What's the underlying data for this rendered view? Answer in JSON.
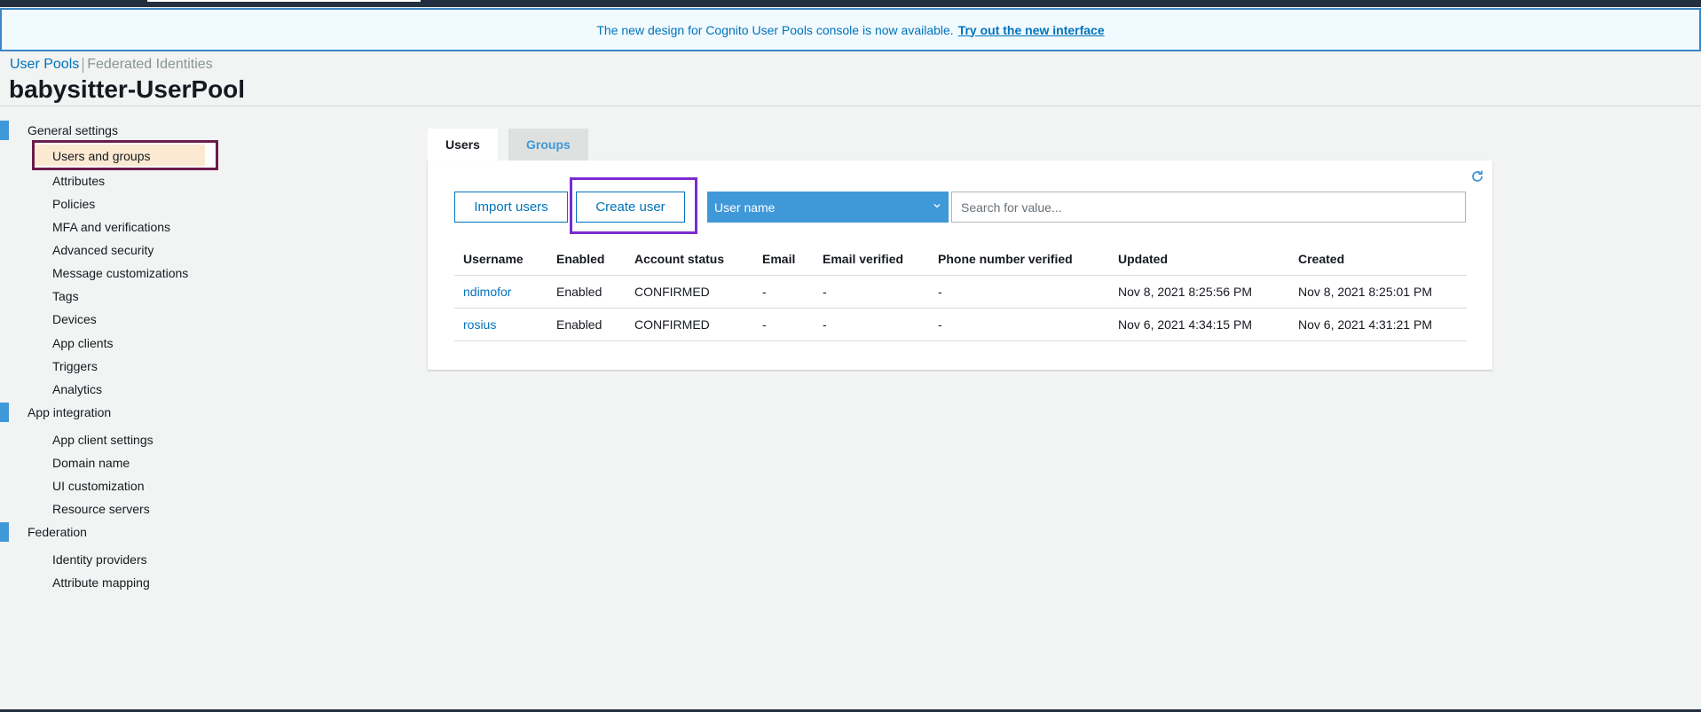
{
  "banner": {
    "text": "The new design for Cognito User Pools console is now available.",
    "link": "Try out the new interface"
  },
  "breadcrumb": {
    "user_pools": "User Pools",
    "federated_identities": "Federated Identities"
  },
  "page_title": "babysitter-UserPool",
  "sidebar": {
    "sections": [
      {
        "label": "General settings"
      },
      {
        "label": "App integration"
      },
      {
        "label": "Federation"
      }
    ],
    "items": [
      {
        "label": "Users and groups"
      },
      {
        "label": "Attributes"
      },
      {
        "label": "Policies"
      },
      {
        "label": "MFA and verifications"
      },
      {
        "label": "Advanced security"
      },
      {
        "label": "Message customizations"
      },
      {
        "label": "Tags"
      },
      {
        "label": "Devices"
      },
      {
        "label": "App clients"
      },
      {
        "label": "Triggers"
      },
      {
        "label": "Analytics"
      },
      {
        "label": "App client settings"
      },
      {
        "label": "Domain name"
      },
      {
        "label": "UI customization"
      },
      {
        "label": "Resource servers"
      },
      {
        "label": "Identity providers"
      },
      {
        "label": "Attribute mapping"
      }
    ]
  },
  "tabs": [
    {
      "label": "Users"
    },
    {
      "label": "Groups"
    }
  ],
  "toolbar": {
    "import_label": "Import users",
    "create_label": "Create user",
    "select_value": "User name",
    "search_placeholder": "Search for value..."
  },
  "table": {
    "headers": [
      "Username",
      "Enabled",
      "Account status",
      "Email",
      "Email verified",
      "Phone number verified",
      "Updated",
      "Created"
    ],
    "rows": [
      [
        "ndimofor",
        "Enabled",
        "CONFIRMED",
        "-",
        "-",
        "-",
        "Nov 8, 2021 8:25:56 PM",
        "Nov 8, 2021 8:25:01 PM"
      ],
      [
        "rosius",
        "Enabled",
        "CONFIRMED",
        "-",
        "-",
        "-",
        "Nov 6, 2021 4:34:15 PM",
        "Nov 6, 2021 4:31:21 PM"
      ]
    ]
  },
  "icons": {
    "refresh": "refresh-icon",
    "dropdown": "chevron-down-icon"
  },
  "colors": {
    "accent": "#0073bb",
    "select_bg": "#3f98d8",
    "nav_highlight": "#fbe9d2",
    "highlight_frame_nav": "#6b1c4a",
    "highlight_frame_button": "#7a2bd0"
  }
}
